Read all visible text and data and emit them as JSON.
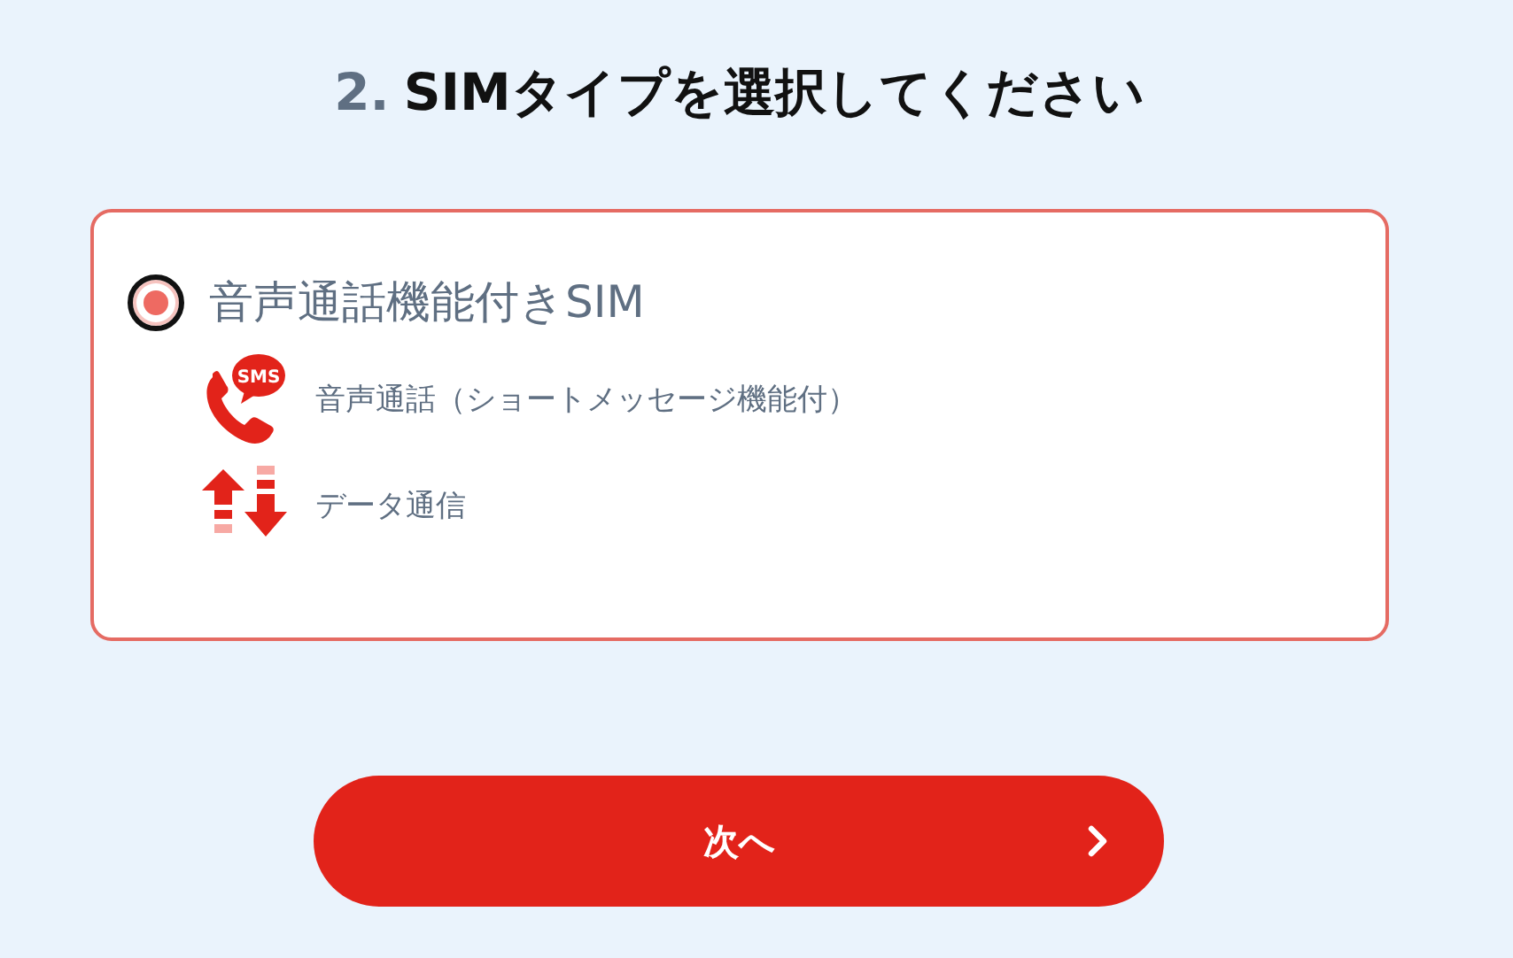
{
  "heading": {
    "number": "2.",
    "title": "SIMタイプを選択してください"
  },
  "options": [
    {
      "label": "音声通話機能付きSIM",
      "selected": true,
      "features": [
        {
          "kind": "voice",
          "badge": "SMS",
          "text": "音声通話（ショートメッセージ機能付）"
        },
        {
          "kind": "data",
          "text": "データ通信"
        }
      ]
    }
  ],
  "next_button": {
    "label": "次へ"
  }
}
